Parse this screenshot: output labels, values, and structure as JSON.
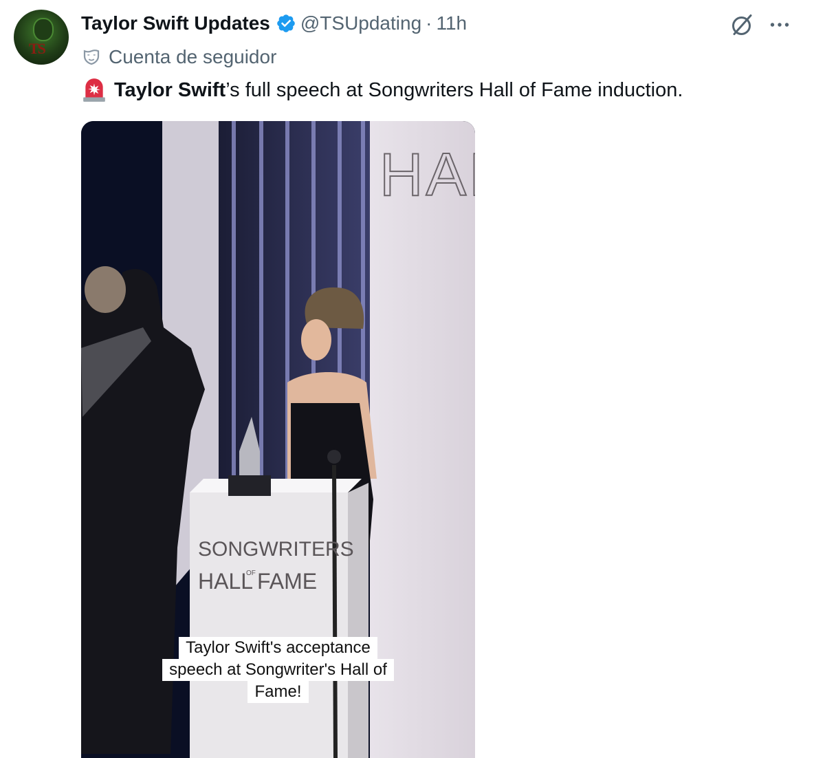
{
  "tweet": {
    "display_name": "Taylor Swift Updates",
    "handle": "@TSUpdating",
    "separator": "·",
    "time": "11h",
    "context_label": "Cuenta de seguidor",
    "text_bold": "Taylor Swift",
    "text_rest": "’s full speech at Songwriters Hall of Fame induction.",
    "icons": {
      "avatar": "avatar-image",
      "verified": "verified-badge-icon",
      "context": "mask-icon",
      "emoji": "police-light-emoji",
      "grok": "grok-icon",
      "more": "more-options-icon"
    },
    "colors": {
      "text": "#0f1419",
      "secondary": "#536471",
      "verified": "#1d9bf0"
    }
  },
  "media": {
    "wall_text": "HALL",
    "podium_line1": "SONGWRITERS",
    "podium_line2": "HALL",
    "podium_of": "OF",
    "podium_line3": "FAME",
    "caption_line1": "Taylor Swift's acceptance",
    "caption_line2": "speech at Songwriter's Hall of",
    "caption_line3": "Fame!"
  }
}
